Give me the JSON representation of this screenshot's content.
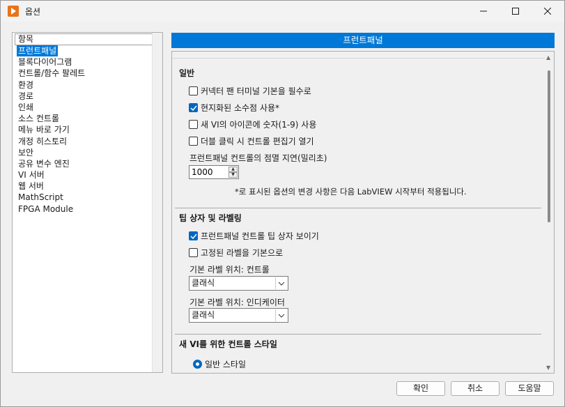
{
  "window": {
    "title": "옵션"
  },
  "sidebar": {
    "header": "항목",
    "items": [
      {
        "label": "프런트패널",
        "selected": true
      },
      {
        "label": "블록다이어그램"
      },
      {
        "label": "컨트롤/함수 팔레트"
      },
      {
        "label": "환경"
      },
      {
        "label": "경로"
      },
      {
        "label": "인쇄"
      },
      {
        "label": "소스 컨트롤"
      },
      {
        "label": "메뉴 바로 가기"
      },
      {
        "label": "개정 히스토리"
      },
      {
        "label": "보안"
      },
      {
        "label": "공유 변수 엔진"
      },
      {
        "label": "VI 서버"
      },
      {
        "label": "웹 서버"
      },
      {
        "label": "MathScript"
      },
      {
        "label": "FPGA Module"
      }
    ]
  },
  "panel": {
    "title": "프런트패널",
    "general": {
      "title": "일반",
      "cb1": {
        "label": "커넥터 팬 터미널 기본을 필수로",
        "checked": false
      },
      "cb2": {
        "label": "현지화된 소수점 사용*",
        "checked": true
      },
      "cb3": {
        "label": "새 VI의 아이콘에 숫자(1-9) 사용",
        "checked": false
      },
      "cb4": {
        "label": "더블 클릭 시 컨트롤 편집기 열기",
        "checked": false
      },
      "delay_label": "프런트패널 컨트롤의 점멸 지연(밀리초)",
      "delay_value": "1000",
      "note": "*로 표시된 옵션의 변경 사항은 다음 LabVIEW 시작부터 적용됩니다."
    },
    "tips": {
      "title": "팁 상자 및 라벨링",
      "cb1": {
        "label": "프런트패널 컨트롤 팁 상자 보이기",
        "checked": true
      },
      "cb2": {
        "label": "고정된 라벨을 기본으로",
        "checked": false
      },
      "control_label": "기본 라벨 위치: 컨트롤",
      "control_value": "클래식",
      "indicator_label": "기본 라벨 위치: 인디케이터",
      "indicator_value": "클래식"
    },
    "style": {
      "title": "새 VI를 위한 컨트롤 스타일",
      "radio1": {
        "label": "일반 스타일",
        "selected": true
      }
    }
  },
  "buttons": {
    "ok": "확인",
    "cancel": "취소",
    "help": "도움말"
  },
  "colors": {
    "accent": "#0078d7",
    "app_icon": "#e8731a"
  }
}
